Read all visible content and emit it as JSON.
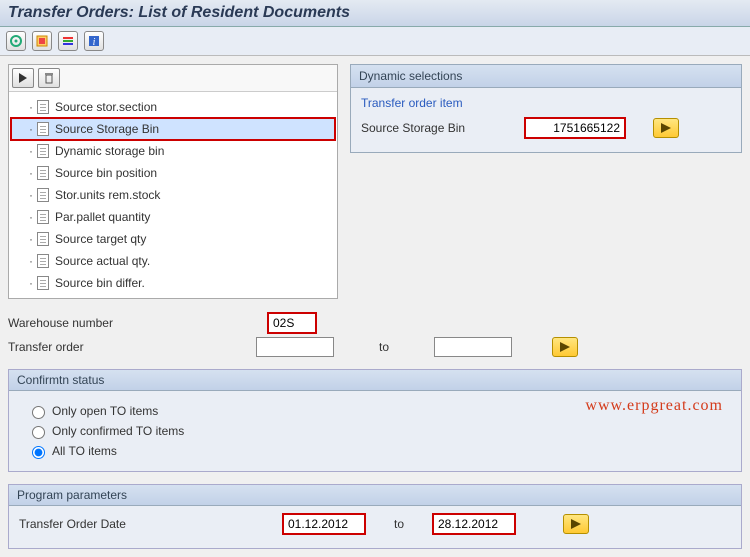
{
  "title": "Transfer Orders: List of Resident Documents",
  "toolbar_icons": [
    "execute",
    "variant",
    "stripes",
    "info"
  ],
  "tree_controls": [
    "run",
    "delete"
  ],
  "tree_items": [
    {
      "label": "Source stor.section",
      "selected": false
    },
    {
      "label": "Source Storage Bin",
      "selected": true
    },
    {
      "label": "Dynamic storage bin",
      "selected": false
    },
    {
      "label": "Source bin position",
      "selected": false
    },
    {
      "label": "Stor.units rem.stock",
      "selected": false
    },
    {
      "label": "Par.pallet quantity",
      "selected": false
    },
    {
      "label": "Source target qty",
      "selected": false
    },
    {
      "label": "Source actual qty.",
      "selected": false
    },
    {
      "label": "Source bin differ.",
      "selected": false
    }
  ],
  "dynsel": {
    "title": "Dynamic selections",
    "subtitle": "Transfer order item",
    "field_label": "Source Storage Bin",
    "value": "1751665122"
  },
  "wh_label": "Warehouse number",
  "wh_value": "02S",
  "to_label": "Transfer order",
  "to_value": "",
  "to_word": "to",
  "to_value_to": "",
  "confirm": {
    "title": "Confirmtn status",
    "opts": [
      "Only open TO items",
      "Only confirmed TO items",
      "All TO items"
    ],
    "selected": 2
  },
  "prog": {
    "title": "Program parameters",
    "date_label": "Transfer Order Date",
    "from": "01.12.2012",
    "to_word": "to",
    "to": "28.12.2012"
  },
  "watermark": "www.erpgreat.com"
}
